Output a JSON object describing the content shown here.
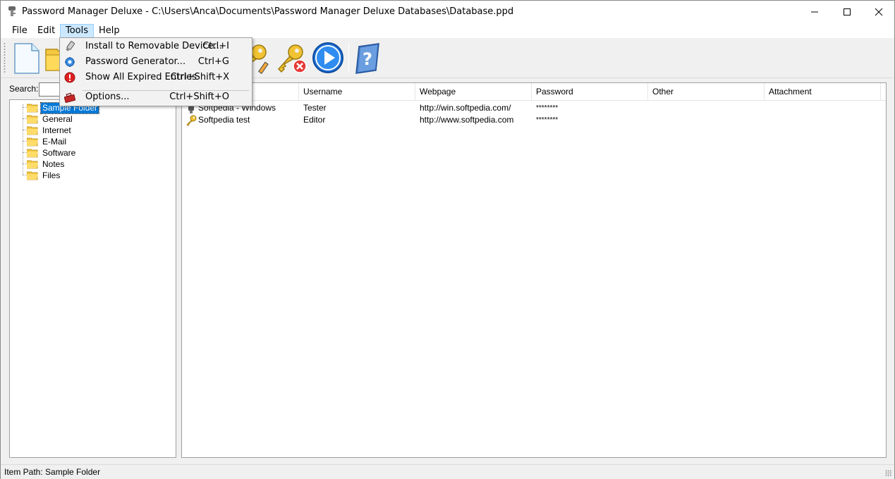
{
  "window": {
    "title": "Password Manager Deluxe - C:\\Users\\Anca\\Documents\\Password Manager Deluxe Databases\\Database.ppd"
  },
  "menubar": {
    "items": [
      {
        "label": "File"
      },
      {
        "label": "Edit"
      },
      {
        "label": "Tools"
      },
      {
        "label": "Help"
      }
    ]
  },
  "toolbar": {
    "buttons": [
      {
        "icon": "new-document-icon"
      },
      {
        "icon": "open-folder-icon"
      },
      {
        "icon": "edit-key-icon"
      },
      {
        "icon": "delete-key-icon"
      },
      {
        "icon": "go-icon"
      },
      {
        "icon": "help-icon"
      }
    ]
  },
  "search": {
    "label": "Search:",
    "value": ""
  },
  "tree": {
    "items": [
      {
        "label": "Sample Folder",
        "selected": true
      },
      {
        "label": "General"
      },
      {
        "label": "Internet"
      },
      {
        "label": "E-Mail"
      },
      {
        "label": "Software"
      },
      {
        "label": "Notes"
      },
      {
        "label": "Files"
      }
    ]
  },
  "list": {
    "columns": [
      "Username",
      "Webpage",
      "Password",
      "Other",
      "Attachment"
    ],
    "rows": [
      {
        "title": "Softpedia - Windows",
        "username": "Tester",
        "webpage": "http://win.softpedia.com/",
        "password": "********",
        "icon": "windows-key-icon"
      },
      {
        "title": "Softpedia test",
        "username": "Editor",
        "webpage": "http://www.softpedia.com",
        "password": "********",
        "icon": "key-icon"
      }
    ]
  },
  "tools_menu": {
    "items": [
      {
        "label": "Install to Removable Device...",
        "shortcut": "Ctrl+I",
        "icon": "usb-drive-icon"
      },
      {
        "label": "Password Generator...",
        "shortcut": "Ctrl+G",
        "icon": "gear-globe-icon"
      },
      {
        "label": "Show All Expired Entries",
        "shortcut": "Ctrl+Shift+X",
        "icon": "warning-icon"
      },
      {
        "label": "Options...",
        "shortcut": "Ctrl+Shift+O",
        "icon": "toolbox-icon"
      }
    ]
  },
  "statusbar": {
    "text": "Item Path: Sample Folder"
  },
  "colors": {
    "selection": "#0078d7",
    "menu_highlight": "#cce8ff"
  }
}
